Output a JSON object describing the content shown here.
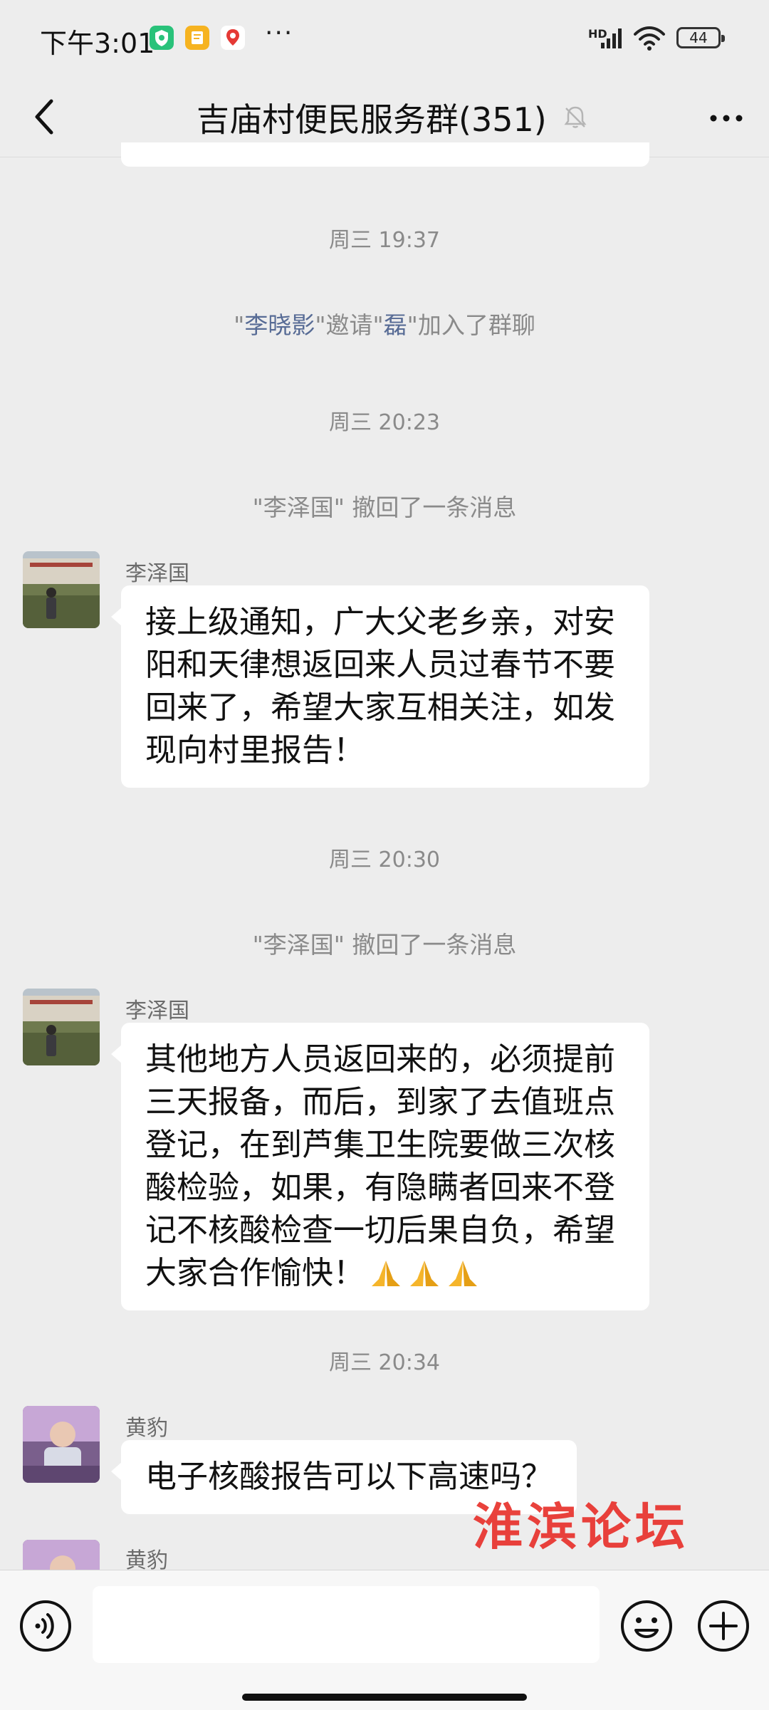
{
  "status_bar": {
    "time": "下午3:01",
    "icons": [
      "shield-app-icon",
      "notes-app-icon",
      "map-pin-app-icon"
    ],
    "more": "···",
    "network": "HD",
    "battery": "44"
  },
  "header": {
    "title": "吉庙村便民服务群(351)",
    "back_icon": "chevron-left-icon",
    "mute_icon": "bell-off-icon",
    "more_icon": "more-dots-icon"
  },
  "messages": [
    {
      "type": "timestamp",
      "text": "周三 19:37"
    },
    {
      "type": "system",
      "q1": "\"",
      "name1": "李晓影",
      "mid": "\"邀请\"",
      "name2": "磊",
      "tail": "\"加入了群聊"
    },
    {
      "type": "timestamp",
      "text": "周三 20:23"
    },
    {
      "type": "system",
      "text": "\"李泽国\" 撤回了一条消息"
    },
    {
      "type": "message",
      "sender": "李泽国",
      "lines": [
        "接上级通知，广大父老乡亲，对安",
        "阳和天律想返回来人员过春节不要",
        "回来了，希望大家互相关注，如发",
        "现向村里报告！"
      ]
    },
    {
      "type": "timestamp",
      "text": "周三 20:30"
    },
    {
      "type": "system",
      "text": "\"李泽国\" 撤回了一条消息"
    },
    {
      "type": "message",
      "sender": "李泽国",
      "lines": [
        "其他地方人员返回来的，必须提前",
        "三天报备，而后，到家了去值班点",
        "登记，在到芦集卫生院要做三次核",
        "酸检验，如果，有隐瞒者回来不登",
        "记不核酸检查一切后果自负，希望",
        "大家合作愉快！"
      ],
      "emoji": "folded-hands-emoji"
    },
    {
      "type": "timestamp",
      "text": "周三 20:34"
    },
    {
      "type": "message",
      "sender": "黄豹",
      "lines": [
        "电子核酸报告可以下高速吗？"
      ]
    },
    {
      "type": "message",
      "sender": "黄豹",
      "lines": []
    }
  ],
  "watermark": "淮滨论坛",
  "input_bar": {
    "voice_icon": "voice-icon",
    "input_value": "",
    "emoji_icon": "smiley-icon",
    "plus_icon": "plus-circle-icon"
  },
  "colors": {
    "background": "#ededed",
    "bubble": "#ffffff",
    "system_text": "#8a8a8a",
    "name_link": "#576b95",
    "watermark": "#e8322c"
  }
}
